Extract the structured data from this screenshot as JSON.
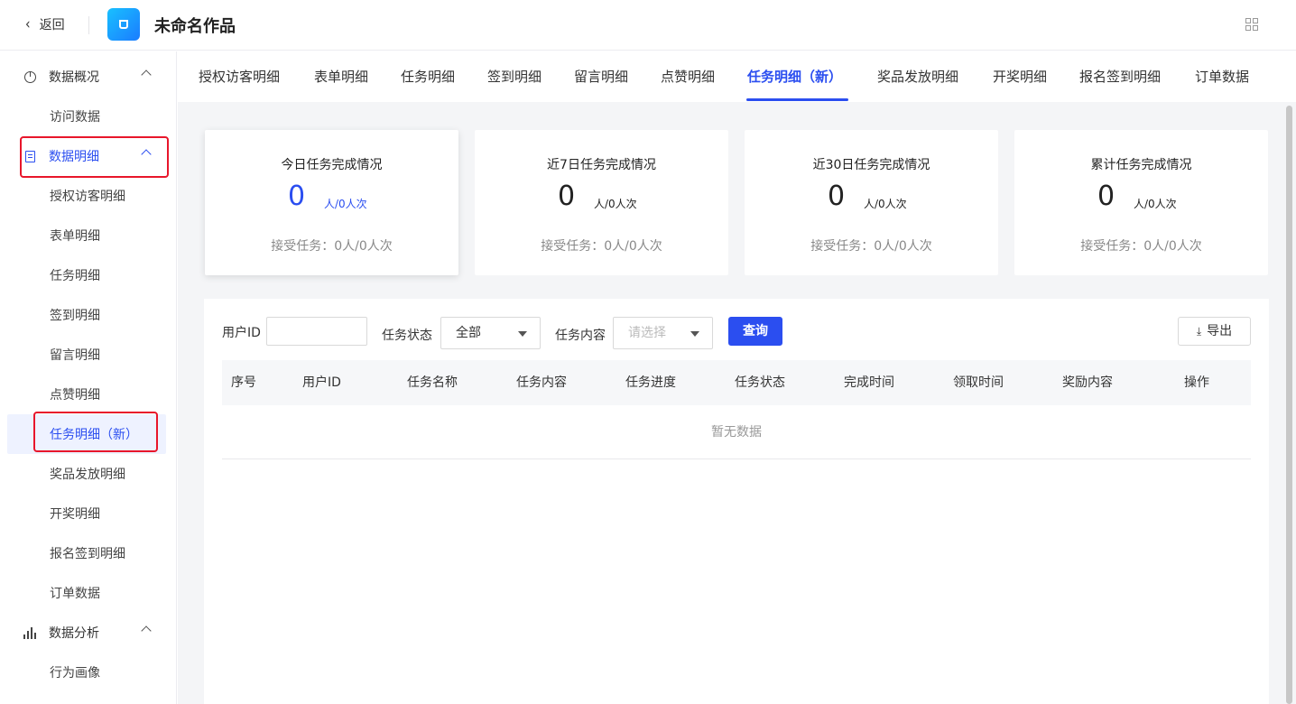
{
  "header": {
    "back_label": "返回",
    "title": "未命名作品",
    "logo_icon": "cup-icon",
    "qr_icon": "qrcode-icon"
  },
  "sidebar": {
    "groups": [
      {
        "label": "数据概况",
        "icon": "pie-chart-icon",
        "expanded": true,
        "items": [
          "访问数据"
        ]
      },
      {
        "label": "数据明细",
        "icon": "document-icon",
        "expanded": true,
        "active": true,
        "items": [
          "授权访客明细",
          "表单明细",
          "任务明细",
          "签到明细",
          "留言明细",
          "点赞明细",
          "任务明细（新）",
          "奖品发放明细",
          "开奖明细",
          "报名签到明细",
          "订单数据"
        ]
      },
      {
        "label": "数据分析",
        "icon": "bar-chart-icon",
        "expanded": true,
        "items": [
          "行为画像"
        ]
      }
    ],
    "selected_item": "任务明细（新）"
  },
  "tabs": [
    "授权访客明细",
    "表单明细",
    "任务明细",
    "签到明细",
    "留言明细",
    "点赞明细",
    "任务明细（新）",
    "奖品发放明细",
    "开奖明细",
    "报名签到明细",
    "订单数据"
  ],
  "active_tab": "任务明细（新）",
  "stats": [
    {
      "title": "今日任务完成情况",
      "value": "0",
      "unit": "人/0人次",
      "sub": "接受任务：0人/0人次"
    },
    {
      "title": "近7日任务完成情况",
      "value": "0",
      "unit": "人/0人次",
      "sub": "接受任务：0人/0人次"
    },
    {
      "title": "近30日任务完成情况",
      "value": "0",
      "unit": "人/0人次",
      "sub": "接受任务：0人/0人次"
    },
    {
      "title": "累计任务完成情况",
      "value": "0",
      "unit": "人/0人次",
      "sub": "接受任务：0人/0人次"
    }
  ],
  "filters": {
    "user_id_label": "用户ID",
    "user_id_value": "",
    "status_label": "任务状态",
    "status_value": "全部",
    "content_label": "任务内容",
    "content_placeholder": "请选择",
    "query_label": "查询",
    "export_label": "导出"
  },
  "table": {
    "columns": [
      "序号",
      "用户ID",
      "任务名称",
      "任务内容",
      "任务进度",
      "任务状态",
      "完成时间",
      "领取时间",
      "奖励内容",
      "操作"
    ],
    "empty_text": "暂无数据"
  },
  "colors": {
    "accent": "#2b4ef0",
    "highlight": "#e8162b"
  }
}
